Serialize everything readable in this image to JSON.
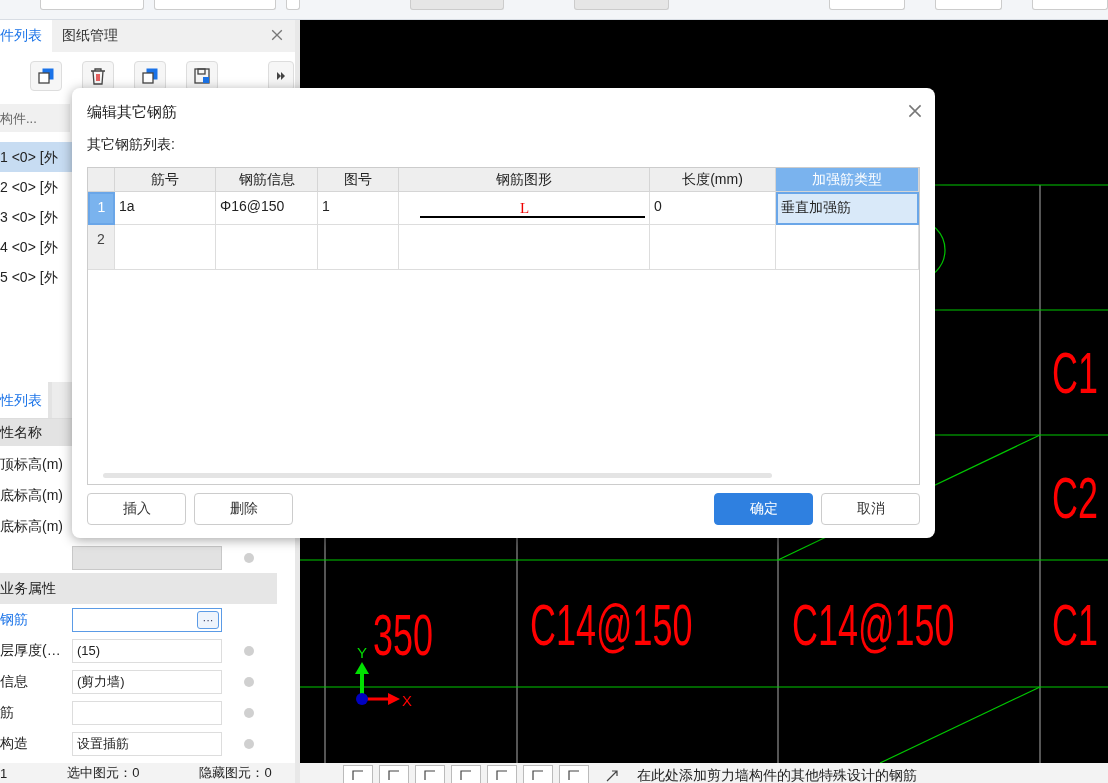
{
  "left_panel": {
    "tabs": [
      {
        "label": "件列表",
        "selected": true
      },
      {
        "label": "图纸管理",
        "selected": false
      }
    ],
    "search": {
      "placeholder": "构件..."
    },
    "components": [
      {
        "label": "1 <0> [外",
        "selected": true
      },
      {
        "label": "2 <0> [外",
        "selected": false
      },
      {
        "label": "3 <0> [外",
        "selected": false
      },
      {
        "label": "4 <0> [外",
        "selected": false
      },
      {
        "label": "5 <0> [外",
        "selected": false
      }
    ],
    "properties_tab": "性列表",
    "properties_header": "性名称",
    "properties": [
      {
        "kind": "label",
        "name": "顶标高(m)"
      },
      {
        "kind": "label",
        "name": "底标高(m)"
      },
      {
        "kind": "label",
        "name": "底标高(m)"
      },
      {
        "kind": "field",
        "disabled": true
      },
      {
        "kind": "section",
        "name": "业务属性"
      },
      {
        "kind": "picker",
        "name": "钢筋",
        "button": "···"
      },
      {
        "kind": "field",
        "name": "层厚度(…",
        "value": "(15)",
        "disabled": false
      },
      {
        "kind": "field",
        "name": "信息",
        "value": "(剪力墙)",
        "disabled": false
      },
      {
        "kind": "field",
        "name": "筋",
        "disabled": false
      },
      {
        "kind": "field",
        "name": "构造",
        "value": "设置插筋",
        "disabled": false
      }
    ],
    "status": [
      "1",
      "选中图元：0",
      "隐藏图元：0"
    ]
  },
  "canvas": {
    "labels": [
      {
        "text": "C1"
      },
      {
        "text": "C2"
      },
      {
        "text": "350"
      },
      {
        "text": "C14@150"
      },
      {
        "text": "C14@150"
      },
      {
        "text": "C1"
      }
    ],
    "axis": {
      "x": "X",
      "y": "Y"
    },
    "hint": "在此处添加剪力墙构件的其他特殊设计的钢筋"
  },
  "dialog": {
    "title": "编辑其它钢筋",
    "list_label": "其它钢筋列表:",
    "columns": [
      {
        "label": "筋号",
        "selected": false
      },
      {
        "label": "钢筋信息",
        "selected": false
      },
      {
        "label": "图号",
        "selected": false
      },
      {
        "label": "钢筋图形",
        "selected": false
      },
      {
        "label": "长度(mm)",
        "selected": false
      },
      {
        "label": "加强筋类型",
        "selected": true
      }
    ],
    "rows": [
      {
        "number": "1",
        "selected": true,
        "bar_no": "1a",
        "info": "Φ16@150",
        "figure_no": "1",
        "shape_mark": "L",
        "length": "0",
        "type": "垂直加强筋"
      },
      {
        "number": "2",
        "selected": false
      }
    ],
    "buttons": [
      {
        "label": "插入",
        "kind": "secondary"
      },
      {
        "label": "删除",
        "kind": "secondary"
      },
      {
        "label": "确定",
        "kind": "primary"
      },
      {
        "label": "取消",
        "kind": "secondary"
      }
    ]
  }
}
